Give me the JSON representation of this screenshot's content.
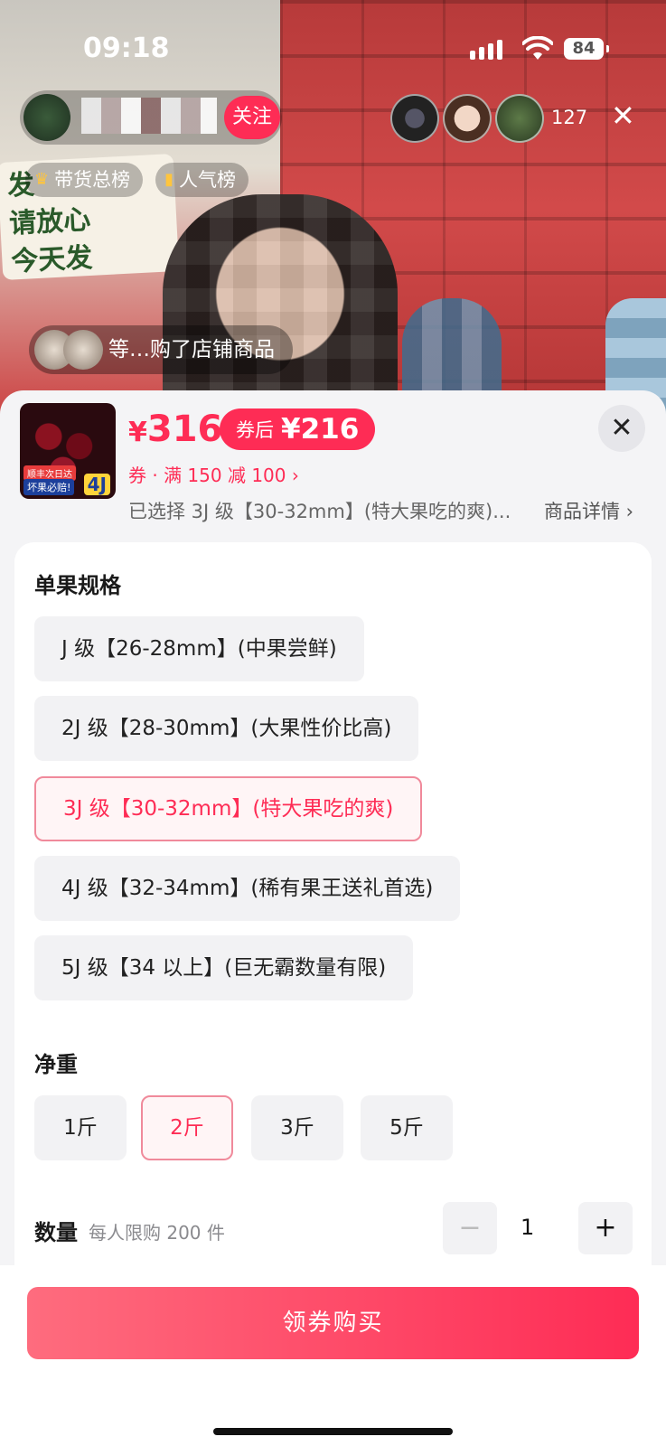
{
  "status_bar": {
    "time": "09:18",
    "battery": "84"
  },
  "live": {
    "follow_label": "关注",
    "viewer_count": "127",
    "rank_tags": [
      "带货总榜",
      "人气榜"
    ],
    "poster_lines": [
      "发",
      "请放心",
      "今天发"
    ],
    "product_pill_text": "等…购了店铺商品"
  },
  "product": {
    "thumb_badges": [
      "顺丰次日达",
      "坏果必赔!",
      "4J"
    ],
    "price_yen": "¥",
    "price_value": "316",
    "after_coupon_label": "券后",
    "after_coupon_value": "¥216",
    "coupon_text": "券 · 满 150 减 100 ›",
    "selected_text": "已选择 3J 级【30-32mm】(特大果吃的爽)...",
    "detail_link": "商品详情 ›"
  },
  "spec": {
    "title": "单果规格",
    "options": [
      "J 级【26-28mm】(中果尝鲜)",
      "2J 级【28-30mm】(大果性价比高)",
      "3J 级【30-32mm】(特大果吃的爽)",
      "4J 级【32-34mm】(稀有果王送礼首选)",
      "5J 级【34 以上】(巨无霸数量有限)"
    ],
    "selected_index": 2
  },
  "weight": {
    "title": "净重",
    "options": [
      "1斤",
      "2斤",
      "3斤",
      "5斤"
    ],
    "selected_index": 1
  },
  "quantity": {
    "label": "数量",
    "hint": "每人限购 200 件",
    "value": "1",
    "minus": "−",
    "plus": "+"
  },
  "buy_button": "领券购买"
}
